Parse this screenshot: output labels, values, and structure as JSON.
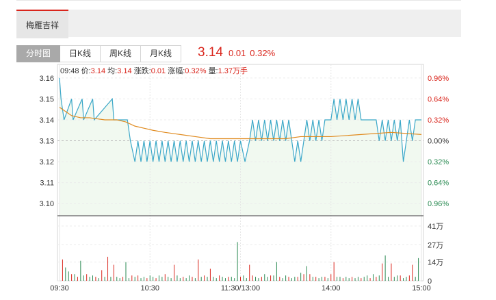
{
  "stock_tab": {
    "label": "梅雁吉祥"
  },
  "period_tabs": [
    {
      "label": "分时图",
      "active": true
    },
    {
      "label": "日K线",
      "active": false
    },
    {
      "label": "周K线",
      "active": false
    },
    {
      "label": "月K线",
      "active": false
    }
  ],
  "quote": {
    "price": "3.14",
    "change": "0.01",
    "change_pct": "0.32%"
  },
  "info": {
    "time": "09:48",
    "price_label": "价:",
    "price": "3.14",
    "avg_label": "均:",
    "avg": "3.14",
    "change_label": "涨跌:",
    "change": "0.01",
    "amp_label": "涨幅:",
    "amp": "0.32%",
    "vol_label": "量:",
    "vol": "1.37万手"
  },
  "colors": {
    "up": "#d9251c",
    "down": "#2a8a52",
    "price_line": "#3aa7c8",
    "avg_line": "#e08a1e",
    "area": "#f1f9f0"
  },
  "chart_data": [
    {
      "type": "line",
      "title": "",
      "x_ticks": [
        "09:30",
        "10:30",
        "11:30/13:00",
        "14:00",
        "15:00"
      ],
      "y_left_ticks": [
        "3.16",
        "3.15",
        "3.14",
        "3.13",
        "3.12",
        "3.11",
        "3.10"
      ],
      "y_right_ticks": [
        "0.96%",
        "0.64%",
        "0.32%",
        "0.00%",
        "0.32%",
        "0.64%",
        "0.96%"
      ],
      "ylim": [
        3.0945,
        3.1665
      ],
      "reference_price": 3.13,
      "series": [
        {
          "name": "价",
          "segments": [
            [
              0,
              3.16
            ],
            [
              1,
              3.15
            ],
            [
              3,
              3.14
            ],
            [
              8,
              3.15
            ],
            [
              9,
              3.14
            ],
            [
              15,
              3.15
            ],
            [
              16,
              3.14
            ],
            [
              22,
              3.15
            ],
            [
              23,
              3.14
            ],
            [
              35,
              3.15
            ],
            [
              36,
              3.14
            ],
            [
              45,
              3.14
            ],
            [
              47,
              3.13
            ],
            [
              50,
              3.12
            ],
            [
              52,
              3.13
            ],
            [
              54,
              3.12
            ],
            [
              56,
              3.13
            ],
            [
              58,
              3.12
            ],
            [
              60,
              3.13
            ],
            [
              62,
              3.12
            ],
            [
              64,
              3.13
            ],
            [
              66,
              3.12
            ],
            [
              68,
              3.13
            ],
            [
              70,
              3.12
            ],
            [
              72,
              3.13
            ],
            [
              74,
              3.12
            ],
            [
              76,
              3.13
            ],
            [
              78,
              3.12
            ],
            [
              80,
              3.13
            ],
            [
              82,
              3.12
            ],
            [
              84,
              3.13
            ],
            [
              86,
              3.12
            ],
            [
              88,
              3.13
            ],
            [
              90,
              3.12
            ],
            [
              92,
              3.13
            ],
            [
              94,
              3.12
            ],
            [
              96,
              3.13
            ],
            [
              98,
              3.12
            ],
            [
              100,
              3.13
            ],
            [
              102,
              3.12
            ],
            [
              104,
              3.13
            ],
            [
              106,
              3.12
            ],
            [
              108,
              3.13
            ],
            [
              110,
              3.12
            ],
            [
              112,
              3.13
            ],
            [
              114,
              3.12
            ],
            [
              116,
              3.13
            ],
            [
              118,
              3.12
            ],
            [
              120,
              3.13
            ],
            [
              123,
              3.12
            ],
            [
              126,
              3.13
            ],
            [
              128,
              3.14
            ],
            [
              130,
              3.13
            ],
            [
              132,
              3.14
            ],
            [
              134,
              3.13
            ],
            [
              136,
              3.14
            ],
            [
              138,
              3.13
            ],
            [
              140,
              3.14
            ],
            [
              142,
              3.13
            ],
            [
              144,
              3.14
            ],
            [
              146,
              3.13
            ],
            [
              148,
              3.14
            ],
            [
              150,
              3.13
            ],
            [
              152,
              3.14
            ],
            [
              154,
              3.13
            ],
            [
              156,
              3.12
            ],
            [
              158,
              3.13
            ],
            [
              160,
              3.12
            ],
            [
              162,
              3.13
            ],
            [
              164,
              3.14
            ],
            [
              166,
              3.13
            ],
            [
              168,
              3.14
            ],
            [
              170,
              3.13
            ],
            [
              172,
              3.14
            ],
            [
              174,
              3.13
            ],
            [
              176,
              3.14
            ],
            [
              180,
              3.14
            ],
            [
              182,
              3.15
            ],
            [
              184,
              3.14
            ],
            [
              186,
              3.15
            ],
            [
              188,
              3.14
            ],
            [
              190,
              3.15
            ],
            [
              192,
              3.14
            ],
            [
              194,
              3.15
            ],
            [
              196,
              3.14
            ],
            [
              198,
              3.15
            ],
            [
              200,
              3.14
            ],
            [
              210,
              3.14
            ],
            [
              212,
              3.13
            ],
            [
              214,
              3.14
            ],
            [
              216,
              3.13
            ],
            [
              218,
              3.14
            ],
            [
              220,
              3.13
            ],
            [
              222,
              3.14
            ],
            [
              224,
              3.13
            ],
            [
              226,
              3.14
            ],
            [
              228,
              3.12
            ],
            [
              230,
              3.13
            ],
            [
              232,
              3.14
            ],
            [
              234,
              3.13
            ],
            [
              236,
              3.14
            ],
            [
              240,
              3.14
            ]
          ]
        },
        {
          "name": "均",
          "segments": [
            [
              0,
              3.146
            ],
            [
              4,
              3.144
            ],
            [
              8,
              3.142
            ],
            [
              14,
              3.141
            ],
            [
              20,
              3.141
            ],
            [
              30,
              3.14
            ],
            [
              38,
              3.14
            ],
            [
              44,
              3.139
            ],
            [
              50,
              3.137
            ],
            [
              56,
              3.136
            ],
            [
              62,
              3.135
            ],
            [
              70,
              3.134
            ],
            [
              80,
              3.133
            ],
            [
              90,
              3.132
            ],
            [
              100,
              3.131
            ],
            [
              120,
              3.131
            ],
            [
              150,
              3.131
            ],
            [
              160,
              3.132
            ],
            [
              180,
              3.132
            ],
            [
              200,
              3.133
            ],
            [
              220,
              3.134
            ],
            [
              240,
              3.133
            ]
          ]
        }
      ]
    },
    {
      "type": "bar",
      "title": "",
      "y_ticks": [
        "41万",
        "27万",
        "14万",
        "0"
      ],
      "ylim": [
        0,
        41
      ],
      "units": "万",
      "bars": [
        [
          2,
          16,
          "up"
        ],
        [
          4,
          10,
          "down"
        ],
        [
          6,
          7,
          "down"
        ],
        [
          8,
          5,
          "up"
        ],
        [
          10,
          5,
          "down"
        ],
        [
          12,
          3,
          "up"
        ],
        [
          14,
          15,
          "down"
        ],
        [
          16,
          4,
          "down"
        ],
        [
          18,
          5,
          "up"
        ],
        [
          20,
          3,
          "down"
        ],
        [
          22,
          4,
          "down"
        ],
        [
          24,
          3,
          "up"
        ],
        [
          26,
          2,
          "down"
        ],
        [
          28,
          8,
          "up"
        ],
        [
          30,
          3,
          "down"
        ],
        [
          32,
          18,
          "up"
        ],
        [
          34,
          3,
          "down"
        ],
        [
          36,
          12,
          "up"
        ],
        [
          38,
          3,
          "down"
        ],
        [
          40,
          2,
          "down"
        ],
        [
          42,
          3,
          "up"
        ],
        [
          44,
          14,
          "down"
        ],
        [
          46,
          2,
          "down"
        ],
        [
          48,
          4,
          "up"
        ],
        [
          50,
          3,
          "down"
        ],
        [
          52,
          4,
          "up"
        ],
        [
          54,
          2,
          "down"
        ],
        [
          56,
          3,
          "down"
        ],
        [
          58,
          2,
          "up"
        ],
        [
          60,
          4,
          "down"
        ],
        [
          62,
          3,
          "down"
        ],
        [
          64,
          2,
          "up"
        ],
        [
          66,
          4,
          "down"
        ],
        [
          68,
          3,
          "down"
        ],
        [
          70,
          5,
          "up"
        ],
        [
          72,
          3,
          "down"
        ],
        [
          74,
          2,
          "down"
        ],
        [
          76,
          12,
          "up"
        ],
        [
          78,
          4,
          "down"
        ],
        [
          80,
          2,
          "down"
        ],
        [
          82,
          3,
          "up"
        ],
        [
          84,
          2,
          "down"
        ],
        [
          86,
          4,
          "down"
        ],
        [
          88,
          3,
          "up"
        ],
        [
          90,
          2,
          "down"
        ],
        [
          92,
          16,
          "up"
        ],
        [
          94,
          3,
          "down"
        ],
        [
          96,
          4,
          "up"
        ],
        [
          98,
          3,
          "down"
        ],
        [
          100,
          9,
          "up"
        ],
        [
          102,
          3,
          "down"
        ],
        [
          104,
          2,
          "down"
        ],
        [
          106,
          4,
          "up"
        ],
        [
          108,
          3,
          "down"
        ],
        [
          110,
          2,
          "down"
        ],
        [
          112,
          3,
          "up"
        ],
        [
          114,
          3,
          "down"
        ],
        [
          116,
          2,
          "down"
        ],
        [
          118,
          29,
          "down"
        ],
        [
          120,
          3,
          "up"
        ],
        [
          122,
          4,
          "down"
        ],
        [
          124,
          2,
          "down"
        ],
        [
          126,
          12,
          "up"
        ],
        [
          128,
          4,
          "up"
        ],
        [
          130,
          3,
          "down"
        ],
        [
          132,
          2,
          "down"
        ],
        [
          134,
          3,
          "up"
        ],
        [
          136,
          5,
          "down"
        ],
        [
          138,
          3,
          "down"
        ],
        [
          140,
          4,
          "up"
        ],
        [
          142,
          4,
          "down"
        ],
        [
          144,
          14,
          "down"
        ],
        [
          146,
          3,
          "up"
        ],
        [
          148,
          2,
          "down"
        ],
        [
          150,
          4,
          "down"
        ],
        [
          152,
          3,
          "up"
        ],
        [
          154,
          2,
          "down"
        ],
        [
          156,
          3,
          "down"
        ],
        [
          158,
          3,
          "up"
        ],
        [
          160,
          6,
          "down"
        ],
        [
          162,
          5,
          "up"
        ],
        [
          164,
          11,
          "down"
        ],
        [
          166,
          5,
          "up"
        ],
        [
          168,
          3,
          "down"
        ],
        [
          170,
          3,
          "up"
        ],
        [
          172,
          2,
          "down"
        ],
        [
          174,
          3,
          "down"
        ],
        [
          176,
          3,
          "up"
        ],
        [
          178,
          2,
          "down"
        ],
        [
          180,
          5,
          "up"
        ],
        [
          182,
          14,
          "up"
        ],
        [
          184,
          3,
          "down"
        ],
        [
          186,
          3,
          "down"
        ],
        [
          188,
          2,
          "up"
        ],
        [
          190,
          3,
          "down"
        ],
        [
          192,
          2,
          "down"
        ],
        [
          194,
          3,
          "up"
        ],
        [
          196,
          2,
          "down"
        ],
        [
          198,
          3,
          "down"
        ],
        [
          200,
          2,
          "up"
        ],
        [
          202,
          3,
          "down"
        ],
        [
          204,
          4,
          "down"
        ],
        [
          206,
          2,
          "up"
        ],
        [
          208,
          5,
          "down"
        ],
        [
          210,
          3,
          "up"
        ],
        [
          212,
          4,
          "down"
        ],
        [
          214,
          13,
          "up"
        ],
        [
          216,
          19,
          "down"
        ],
        [
          218,
          3,
          "down"
        ],
        [
          220,
          13,
          "up"
        ],
        [
          222,
          3,
          "down"
        ],
        [
          224,
          4,
          "down"
        ],
        [
          226,
          4,
          "up"
        ],
        [
          228,
          2,
          "down"
        ],
        [
          230,
          3,
          "down"
        ],
        [
          232,
          4,
          "up"
        ],
        [
          234,
          12,
          "up"
        ],
        [
          236,
          3,
          "down"
        ],
        [
          238,
          17,
          "down"
        ]
      ]
    }
  ]
}
